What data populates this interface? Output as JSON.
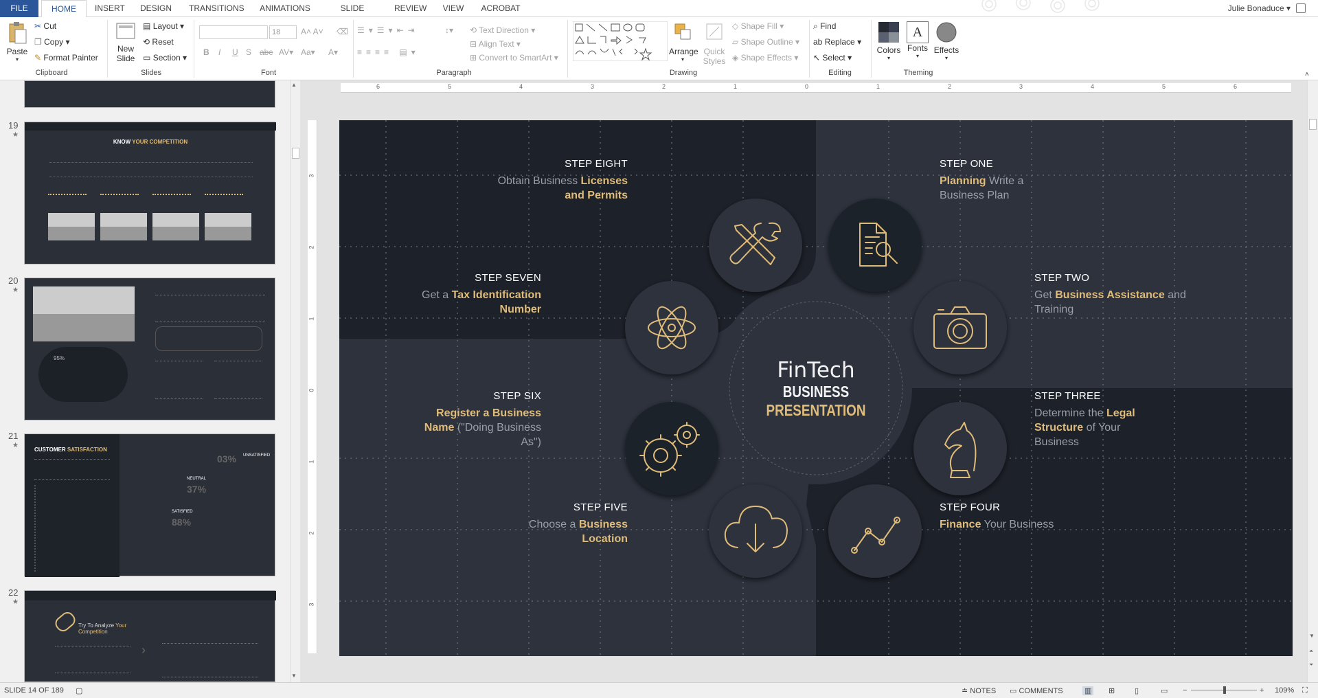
{
  "tabs": [
    "FILE",
    "HOME",
    "INSERT",
    "DESIGN",
    "TRANSITIONS",
    "ANIMATIONS",
    "SLIDE SHOW",
    "REVIEW",
    "VIEW",
    "ACROBAT"
  ],
  "user": "Julie Bonaduce",
  "ribbon": {
    "clipboard": {
      "paste": "Paste",
      "cut": "Cut",
      "copy": "Copy",
      "format_painter": "Format Painter",
      "label": "Clipboard"
    },
    "slides": {
      "new_slide": "New Slide",
      "layout": "Layout",
      "reset": "Reset",
      "section": "Section",
      "label": "Slides"
    },
    "font": {
      "size": "18",
      "label": "Font"
    },
    "paragraph": {
      "text_direction": "Text Direction",
      "align_text": "Align Text",
      "convert": "Convert to SmartArt",
      "label": "Paragraph"
    },
    "drawing": {
      "arrange": "Arrange",
      "quick_styles": "Quick Styles",
      "shape_fill": "Shape Fill",
      "shape_outline": "Shape Outline",
      "shape_effects": "Shape Effects",
      "label": "Drawing"
    },
    "editing": {
      "find": "Find",
      "replace": "Replace",
      "select": "Select",
      "label": "Editing"
    },
    "theming": {
      "colors": "Colors",
      "fonts": "Fonts",
      "effects": "Effects",
      "label": "Theming"
    }
  },
  "thumbnails": [
    {
      "num": "19",
      "title_a": "KNOW ",
      "title_b": "YOUR COMPETITION"
    },
    {
      "num": "20",
      "badge": "95%"
    },
    {
      "num": "21",
      "title_a": "CUSTOMER ",
      "title_b": "SATISFACTION",
      "unsat": "03%",
      "unsat_label": "UNSATISFIED",
      "neutral": "37%",
      "neutral_label": "NEUTRAL",
      "sat": "88%",
      "sat_label": "SATISFIED"
    },
    {
      "num": "22",
      "title_a": "Try To Analyze ",
      "title_b": "Your Competition"
    }
  ],
  "ruler": {
    "h": [
      "6",
      "5",
      "4",
      "3",
      "2",
      "1",
      "0",
      "1",
      "2",
      "3",
      "4",
      "5",
      "6"
    ],
    "v": [
      "3",
      "2",
      "1",
      "0",
      "1",
      "2",
      "3"
    ]
  },
  "slide": {
    "center_title": "FinTech",
    "center_sub_a": "BUSINESS ",
    "center_sub_b": "PRESENTATION",
    "steps": {
      "one": {
        "label": "STEP ONE",
        "b1": "Planning",
        "t1": " Write a Business Plan"
      },
      "two": {
        "label": "STEP TWO",
        "t1": "Get ",
        "b1": "Business Assistance",
        "t2": " and Training"
      },
      "three": {
        "label": "STEP THREE",
        "t1": "Determine the ",
        "b1": "Legal Structure",
        "t2": " of Your Business"
      },
      "four": {
        "label": "STEP FOUR",
        "b1": "Finance",
        "t1": " Your Business"
      },
      "five": {
        "label": "STEP FIVE",
        "t1": "Choose a ",
        "b1": "Business Location"
      },
      "six": {
        "label": "STEP SIX",
        "b1": "Register a Business Name",
        "t1": " (\"Doing Business As\")"
      },
      "seven": {
        "label": "STEP SEVEN",
        "t1": "Get a ",
        "b1": "Tax Identification Number"
      },
      "eight": {
        "label": "STEP EIGHT",
        "t1": "Obtain Business ",
        "b1": "Licenses and Permits"
      }
    }
  },
  "status": {
    "slide": "SLIDE 14 OF 189",
    "notes": "NOTES",
    "comments": "COMMENTS",
    "zoom": "109%"
  },
  "colors": {
    "accent": "#e0bc7a",
    "slide_dark": "#1d2129",
    "slide_mid": "#2d323d",
    "ribbon_blue": "#2b579a"
  }
}
